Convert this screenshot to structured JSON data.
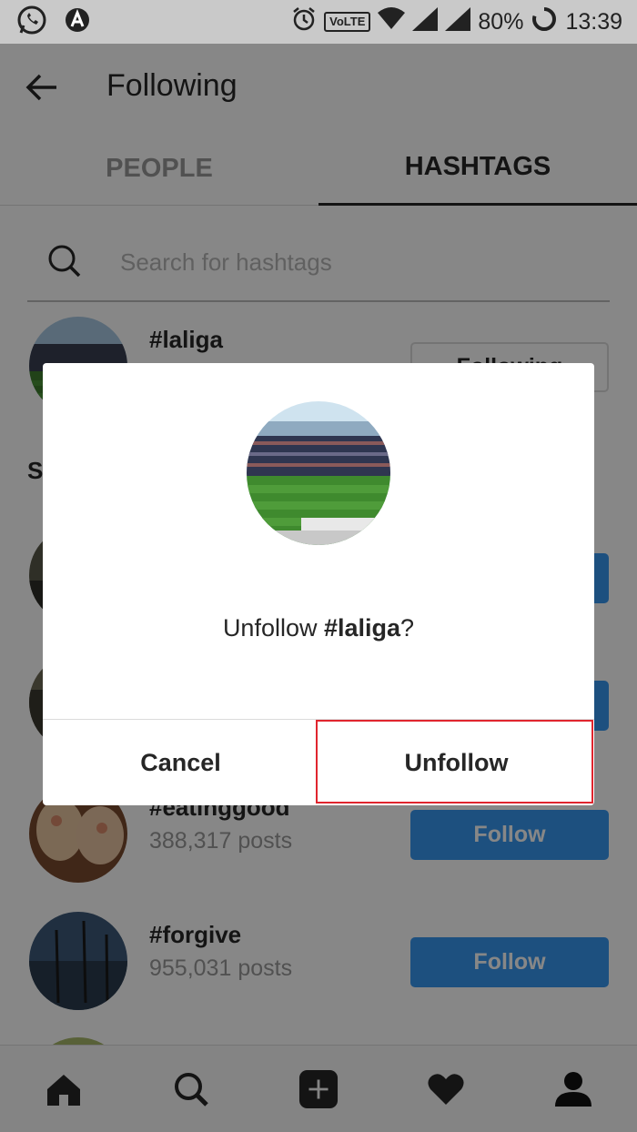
{
  "status_bar": {
    "battery": "80%",
    "time": "13:39",
    "network_label": "VoLTE",
    "icons": [
      "whatsapp-icon",
      "arrow-app-icon",
      "alarm-icon",
      "volte-icon",
      "wifi-icon",
      "signal-icon",
      "signal-icon",
      "battery-icon"
    ]
  },
  "header": {
    "title": "Following",
    "back_icon": "back-arrow-icon"
  },
  "tabs": [
    {
      "label": "PEOPLE",
      "active": false
    },
    {
      "label": "HASHTAGS",
      "active": true
    }
  ],
  "search": {
    "placeholder": "Search for hashtags",
    "value": ""
  },
  "following_list": [
    {
      "tag": "#laliga",
      "button": "Following"
    }
  ],
  "section_initial": "S",
  "suggestions": [
    {
      "tag": "#eatinggood",
      "posts": "388,317 posts",
      "button": "Follow"
    },
    {
      "tag": "#forgive",
      "posts": "955,031 posts",
      "button": "Follow"
    }
  ],
  "bottom_nav": [
    "home-icon",
    "search-icon",
    "add-icon",
    "heart-icon",
    "profile-icon"
  ],
  "dialog": {
    "message_prefix": "Unfollow ",
    "hashtag": "#laliga",
    "message_suffix": "?",
    "cancel_label": "Cancel",
    "unfollow_label": "Unfollow"
  },
  "colors": {
    "follow_button": "#3897f0",
    "highlight": "#e0252e",
    "status_bar": "#c9c9c9"
  }
}
